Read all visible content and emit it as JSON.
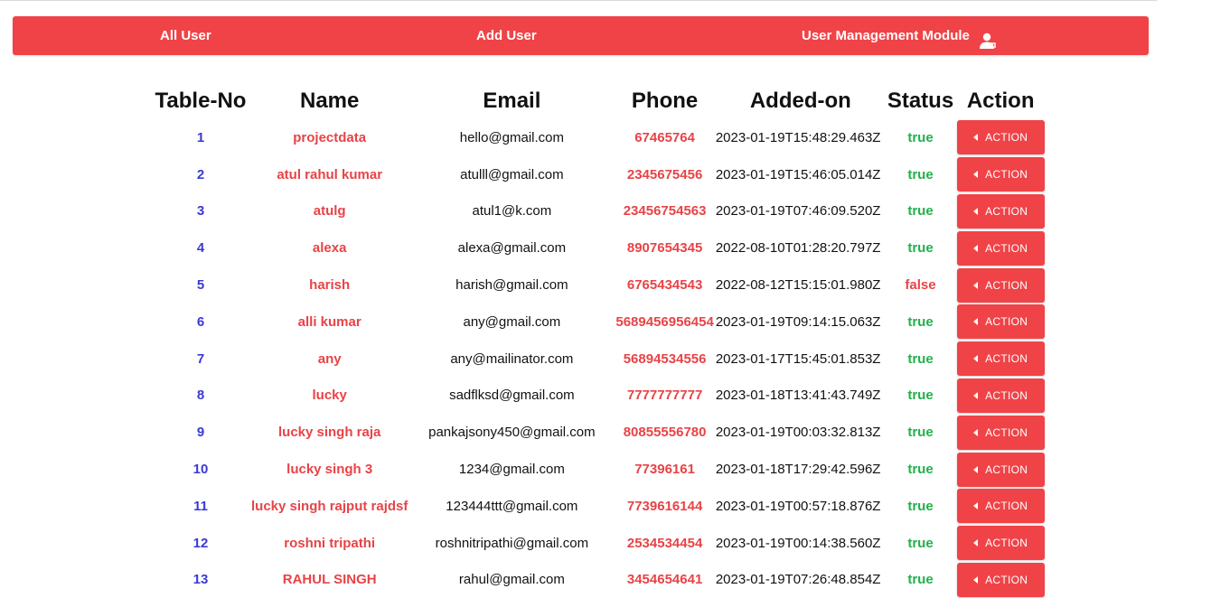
{
  "nav": {
    "all_user": "All User",
    "add_user": "Add User",
    "module_title": "User Management Module",
    "module_icon": "user-icon"
  },
  "colors": {
    "accent": "#f04347",
    "id_text": "#3a3ad4",
    "true_status": "#21b14b",
    "false_status": "#e84346"
  },
  "table": {
    "headers": [
      "Table-No",
      "Name",
      "Email",
      "Phone",
      "Added-on",
      "Status",
      "Action"
    ],
    "action_label": "ACTION",
    "rows": [
      {
        "no": "1",
        "name": "projectdata",
        "email": "hello@gmail.com",
        "phone": "67465764",
        "added": "2023-01-19T15:48:29.463Z",
        "status": "true"
      },
      {
        "no": "2",
        "name": "atul rahul kumar",
        "email": "atulll@gmail.com",
        "phone": "2345675456",
        "added": "2023-01-19T15:46:05.014Z",
        "status": "true"
      },
      {
        "no": "3",
        "name": "atulg",
        "email": "atul1@k.com",
        "phone": "23456754563",
        "added": "2023-01-19T07:46:09.520Z",
        "status": "true"
      },
      {
        "no": "4",
        "name": "alexa",
        "email": "alexa@gmail.com",
        "phone": "8907654345",
        "added": "2022-08-10T01:28:20.797Z",
        "status": "true"
      },
      {
        "no": "5",
        "name": "harish",
        "email": "harish@gmail.com",
        "phone": "6765434543",
        "added": "2022-08-12T15:15:01.980Z",
        "status": "false"
      },
      {
        "no": "6",
        "name": "alli kumar",
        "email": "any@gmail.com",
        "phone": "5689456956454",
        "added": "2023-01-19T09:14:15.063Z",
        "status": "true"
      },
      {
        "no": "7",
        "name": "any",
        "email": "any@mailinator.com",
        "phone": "56894534556",
        "added": "2023-01-17T15:45:01.853Z",
        "status": "true"
      },
      {
        "no": "8",
        "name": "lucky",
        "email": "sadflksd@gmail.com",
        "phone": "7777777777",
        "added": "2023-01-18T13:41:43.749Z",
        "status": "true"
      },
      {
        "no": "9",
        "name": "lucky singh raja",
        "email": "pankajsony450@gmail.com",
        "phone": "80855556780",
        "added": "2023-01-19T00:03:32.813Z",
        "status": "true"
      },
      {
        "no": "10",
        "name": "lucky singh 3",
        "email": "1234@gmail.com",
        "phone": "77396161",
        "added": "2023-01-18T17:29:42.596Z",
        "status": "true"
      },
      {
        "no": "11",
        "name": "lucky singh rajput rajdsf",
        "email": "123444ttt@gmail.com",
        "phone": "7739616144",
        "added": "2023-01-19T00:57:18.876Z",
        "status": "true"
      },
      {
        "no": "12",
        "name": "roshni tripathi",
        "email": "roshnitripathi@gmail.com",
        "phone": "2534534454",
        "added": "2023-01-19T00:14:38.560Z",
        "status": "true"
      },
      {
        "no": "13",
        "name": "RAHUL SINGH",
        "email": "rahul@gmail.com",
        "phone": "3454654641",
        "added": "2023-01-19T07:26:48.854Z",
        "status": "true"
      }
    ]
  }
}
